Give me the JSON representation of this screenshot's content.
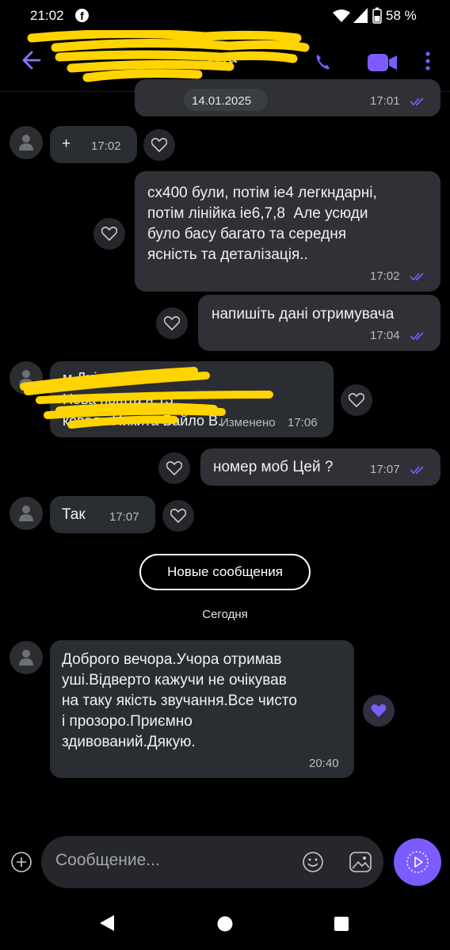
{
  "status_bar": {
    "time": "21:02",
    "battery": "58 %"
  },
  "header": {
    "title": "утта"
  },
  "messages": [
    {
      "text": "14.01.2025",
      "time": "17:01"
    },
    {
      "text": "+",
      "time": "17:02"
    },
    {
      "text": "cx400 були, потім ie4 легкндарні,\nпотім лінійка ie6,7,8  Але усюди\nбуло басу багато та середня\nясність та деталізація..",
      "time": "17:02"
    },
    {
      "text": "напишіть дані отримувача",
      "time": "17:04"
    },
    {
      "text": "м.Дніп\nНова пошта н 13\nковаль Никита Байло В.",
      "edited": "Изменено",
      "time": "17:06"
    },
    {
      "text": "номер моб Цей ?",
      "time": "17:07"
    },
    {
      "text": "Так",
      "time": "17:07"
    },
    {
      "text": "Доброго вечора.Учора отримав\nуші.Відверто кажучи не очікував\nна таку якість звучання.Все чисто\nі прозоро.Приємно\nздивований.Дякую.",
      "time": "20:40"
    }
  ],
  "new_messages_label": "Новые сообщения",
  "today_label": "Сегодня",
  "composer": {
    "placeholder": "Сообщение..."
  },
  "colors": {
    "accent": "#7c5cff",
    "bubble": "#2a2d32",
    "background": "#000000",
    "scribble": "#ffd400"
  }
}
